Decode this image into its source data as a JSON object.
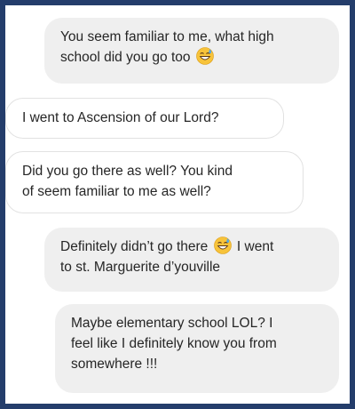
{
  "messages": [
    {
      "sender": "me",
      "lines": [
        "You seem familiar to me, what high",
        "school did you go too"
      ],
      "trailing_emoji": "grinning-sweat-emoji"
    },
    {
      "sender": "them",
      "lines": [
        "I went to Ascension of our Lord?"
      ]
    },
    {
      "sender": "them",
      "lines": [
        "Did you go there as well? You kind",
        "of seem familiar to me as well?"
      ]
    },
    {
      "sender": "me",
      "line1_before": "Definitely didn’t go there",
      "line1_after": "I went",
      "line2": "to st. Marguerite d’youville",
      "inline_emoji": "grinning-sweat-emoji"
    },
    {
      "sender": "me",
      "lines": [
        "Maybe elementary school LOL? I",
        "feel like I definitely know you from",
        "somewhere !!!"
      ]
    }
  ],
  "colors": {
    "sent_bubble": "#efefef",
    "received_bubble": "#ffffff",
    "frame_border": "#243d6b",
    "text": "#262626"
  }
}
